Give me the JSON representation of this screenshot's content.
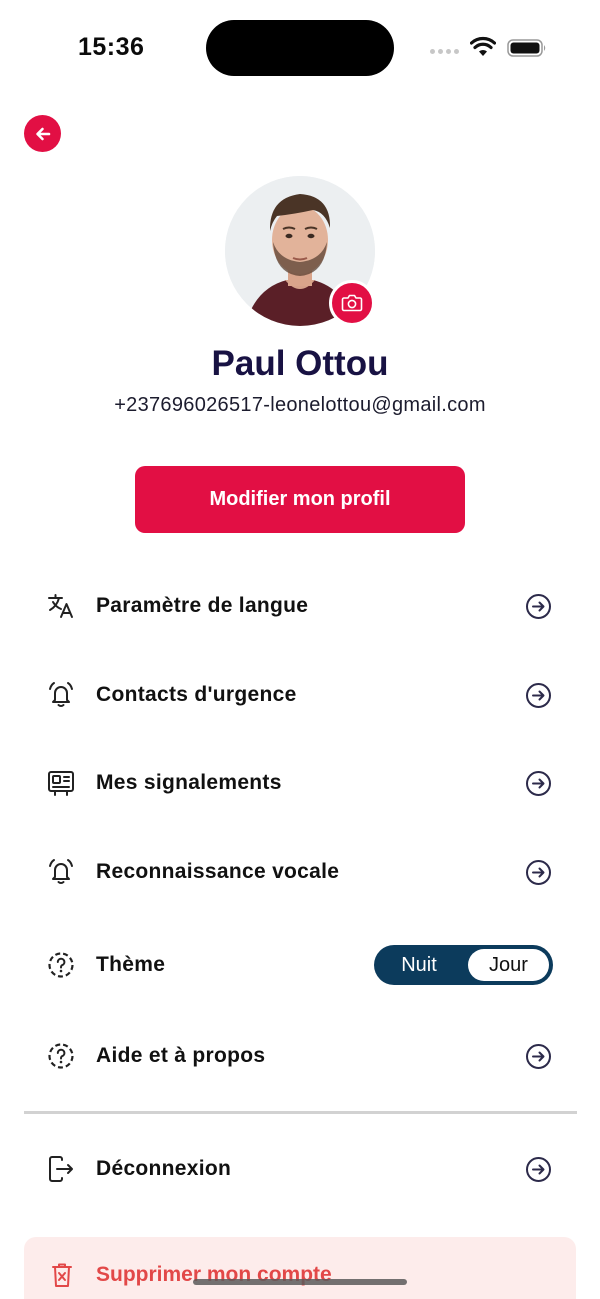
{
  "status_bar": {
    "time": "15:36"
  },
  "profile": {
    "name": "Paul Ottou",
    "contact": "+237696026517-leonelottou@gmail.com",
    "edit_button_label": "Modifier mon profil"
  },
  "menu": {
    "items": [
      {
        "label": "Paramètre de langue",
        "icon": "translate-icon"
      },
      {
        "label": "Contacts d'urgence",
        "icon": "bell-ringing-icon"
      },
      {
        "label": "Mes signalements",
        "icon": "report-screen-icon"
      },
      {
        "label": "Reconnaissance vocale",
        "icon": "bell-ringing-icon"
      },
      {
        "label": "Thème",
        "icon": "help-circle-dashed-icon"
      },
      {
        "label": "Aide et à propos",
        "icon": "help-circle-dashed-icon"
      }
    ],
    "theme_toggle": {
      "night_label": "Nuit",
      "day_label": "Jour",
      "selected": "Jour"
    },
    "logout_label": "Déconnexion",
    "delete_account_label": "Supprimer mon compte"
  },
  "colors": {
    "accent": "#e20f44",
    "toggle_bg": "#0c3b5c",
    "name_color": "#181243",
    "delete_bg": "#fdeceb",
    "delete_text": "#e24848"
  }
}
